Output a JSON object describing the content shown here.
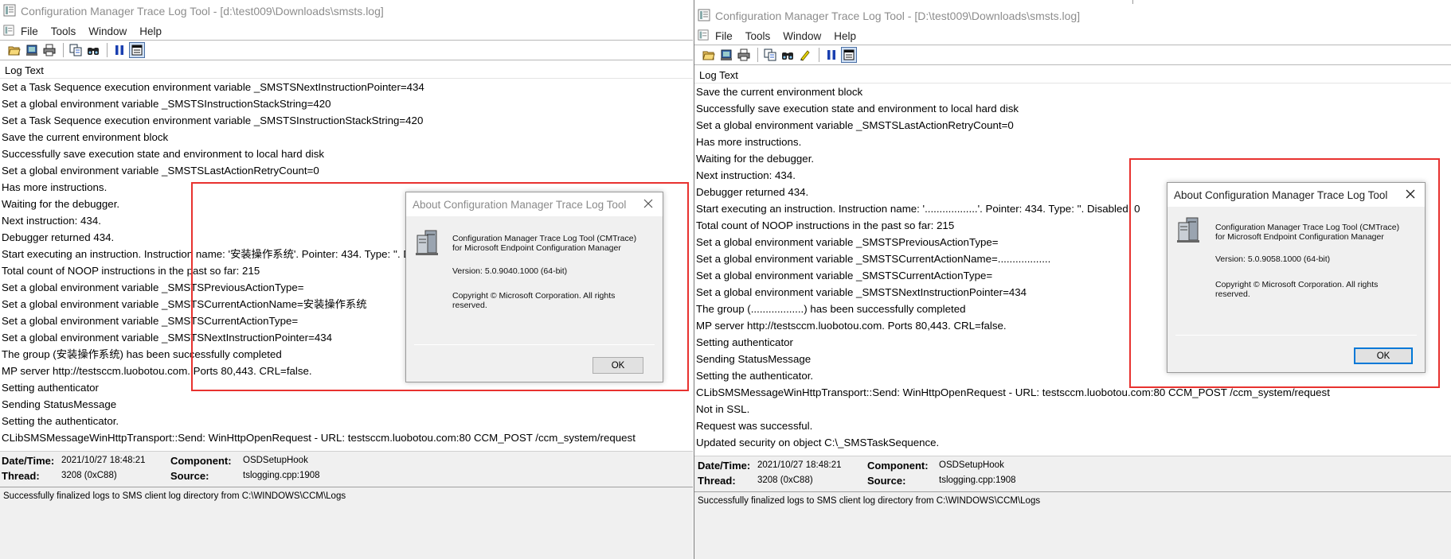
{
  "left": {
    "title": "Configuration Manager Trace Log Tool - [d:\\test009\\Downloads\\smsts.log]",
    "menu": [
      "File",
      "Tools",
      "Window",
      "Help"
    ],
    "log_header": "Log Text",
    "lines": [
      "Set a Task Sequence execution environment variable _SMSTSNextInstructionPointer=434",
      "Set a global environment variable _SMSTSInstructionStackString=420",
      "Set a Task Sequence execution environment variable _SMSTSInstructionStackString=420",
      "Save the current environment block",
      "Successfully save execution state and environment to local hard disk",
      "Set a global environment variable _SMSTSLastActionRetryCount=0",
      "Has more instructions.",
      "Waiting for the debugger.",
      "Next instruction: 434.",
      "Debugger returned 434.",
      "Start executing an instruction. Instruction name: '安装操作系统'.  Pointer: 434. Type: ''. Disa",
      "Total count of NOOP instructions in the past so far: 215",
      "Set a global environment variable _SMSTSPreviousActionType=",
      "Set a global environment variable _SMSTSCurrentActionName=安装操作系统",
      "Set a global environment variable _SMSTSCurrentActionType=",
      "Set a global environment variable _SMSTSNextInstructionPointer=434",
      "The group (安装操作系统) has been successfully completed",
      "MP server http://testsccm.luobotou.com. Ports 80,443. CRL=false.",
      "Setting authenticator",
      "Sending StatusMessage",
      "Setting the authenticator.",
      "CLibSMSMessageWinHttpTransport::Send: WinHttpOpenRequest - URL: testsccm.luobotou.com:80  CCM_POST /ccm_system/request"
    ],
    "detail": {
      "datetime_label": "Date/Time:",
      "datetime": "2021/10/27 18:48:21",
      "component_label": "Component:",
      "component": "OSDSetupHook",
      "thread_label": "Thread:",
      "thread": "3208 (0xC88)",
      "source_label": "Source:",
      "source": "tslogging.cpp:1908"
    },
    "message": "Successfully finalized logs to SMS client log directory from C:\\WINDOWS\\CCM\\Logs",
    "about": {
      "title": "About Configuration Manager Trace Log Tool",
      "product_line1": "Configuration Manager Trace Log Tool (CMTrace)",
      "product_line2": "for Microsoft Endpoint Configuration Manager",
      "version": "Version: 5.0.9040.1000 (64-bit)",
      "copyright_line1": "Copyright © Microsoft Corporation. All rights",
      "copyright_line2": "reserved.",
      "ok": "OK"
    }
  },
  "right": {
    "title": "Configuration Manager Trace Log Tool - [D:\\test009\\Downloads\\smsts.log]",
    "menu": [
      "File",
      "Tools",
      "Window",
      "Help"
    ],
    "log_header": "Log Text",
    "lines": [
      "Save the current environment block",
      "Successfully save execution state and environment to local hard disk",
      "Set a global environment variable _SMSTSLastActionRetryCount=0",
      "Has more instructions.",
      "Waiting for the debugger.",
      "Next instruction: 434.",
      "Debugger returned 434.",
      "Start executing an instruction. Instruction name: '..................'.  Pointer: 434. Type: ''. Disabled: 0",
      "Total count of NOOP instructions in the past so far: 215",
      "Set a global environment variable _SMSTSPreviousActionType=",
      "Set a global environment variable _SMSTSCurrentActionName=..................",
      "Set a global environment variable _SMSTSCurrentActionType=",
      "Set a global environment variable _SMSTSNextInstructionPointer=434",
      "The group (..................) has been successfully completed",
      "MP server http://testsccm.luobotou.com. Ports 80,443. CRL=false.",
      "Setting authenticator",
      "Sending StatusMessage",
      "Setting the authenticator.",
      "CLibSMSMessageWinHttpTransport::Send: WinHttpOpenRequest - URL: testsccm.luobotou.com:80  CCM_POST /ccm_system/request",
      "Not in SSL.",
      "Request was successful.",
      "Updated security on object C:\\_SMSTaskSequence."
    ],
    "detail": {
      "datetime_label": "Date/Time:",
      "datetime": "2021/10/27 18:48:21",
      "component_label": "Component:",
      "component": "OSDSetupHook",
      "thread_label": "Thread:",
      "thread": "3208 (0xC88)",
      "source_label": "Source:",
      "source": "tslogging.cpp:1908"
    },
    "message": "Successfully finalized logs to SMS client log directory from C:\\WINDOWS\\CCM\\Logs",
    "about": {
      "title": "About Configuration Manager Trace Log Tool",
      "product_line1": "Configuration Manager Trace Log Tool (CMTrace)",
      "product_line2": "for Microsoft Endpoint Configuration Manager",
      "version": "Version: 5.0.9058.1000 (64-bit)",
      "copyright_line1": "Copyright © Microsoft Corporation. All rights",
      "copyright_line2": "reserved.",
      "ok": "OK"
    }
  },
  "colors": {
    "highlight_box": "#e8322f",
    "dialog_bg": "#f0f0f0",
    "focus_ring": "#0078d7"
  },
  "icons": [
    "app-icon",
    "open-icon",
    "print-preview-icon",
    "print-icon",
    "copy-icon",
    "find-icon",
    "highlight-icon",
    "pause-icon",
    "view-icon",
    "close-icon",
    "server-icon"
  ]
}
